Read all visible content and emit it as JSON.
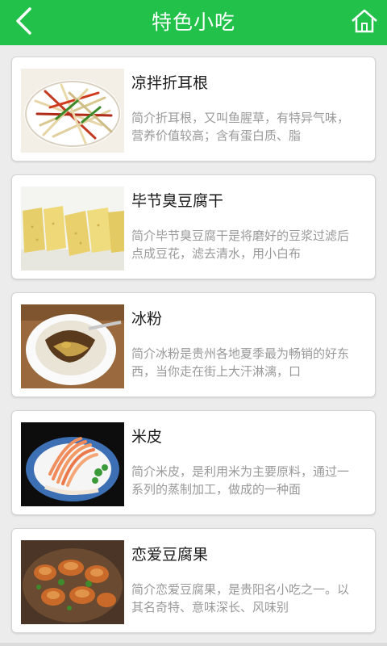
{
  "header": {
    "title": "特色小吃",
    "back_icon": "back-arrow-icon",
    "home_icon": "home-icon",
    "color": "#22c24a"
  },
  "items": [
    {
      "name": "凉拌折耳根",
      "desc": "简介折耳根，又叫鱼腥草，有特异气味，营养价值较高；含有蛋白质、脂"
    },
    {
      "name": "毕节臭豆腐干",
      "desc": "简介毕节臭豆腐干是将磨好的豆浆过滤后点成豆花，滤去清水，用小白布"
    },
    {
      "name": "冰粉",
      "desc": "简介冰粉是贵州各地夏季最为畅销的好东西，当你走在街上大汗淋漓，口"
    },
    {
      "name": "米皮",
      "desc": "简介米皮，是利用米为主要原料，通过一系列的蒸制加工，做成的一种面"
    },
    {
      "name": "恋爱豆腐果",
      "desc": "简介恋爱豆腐果，是贵阳名小吃之一。以其名奇特、意味深长、风味别"
    }
  ]
}
